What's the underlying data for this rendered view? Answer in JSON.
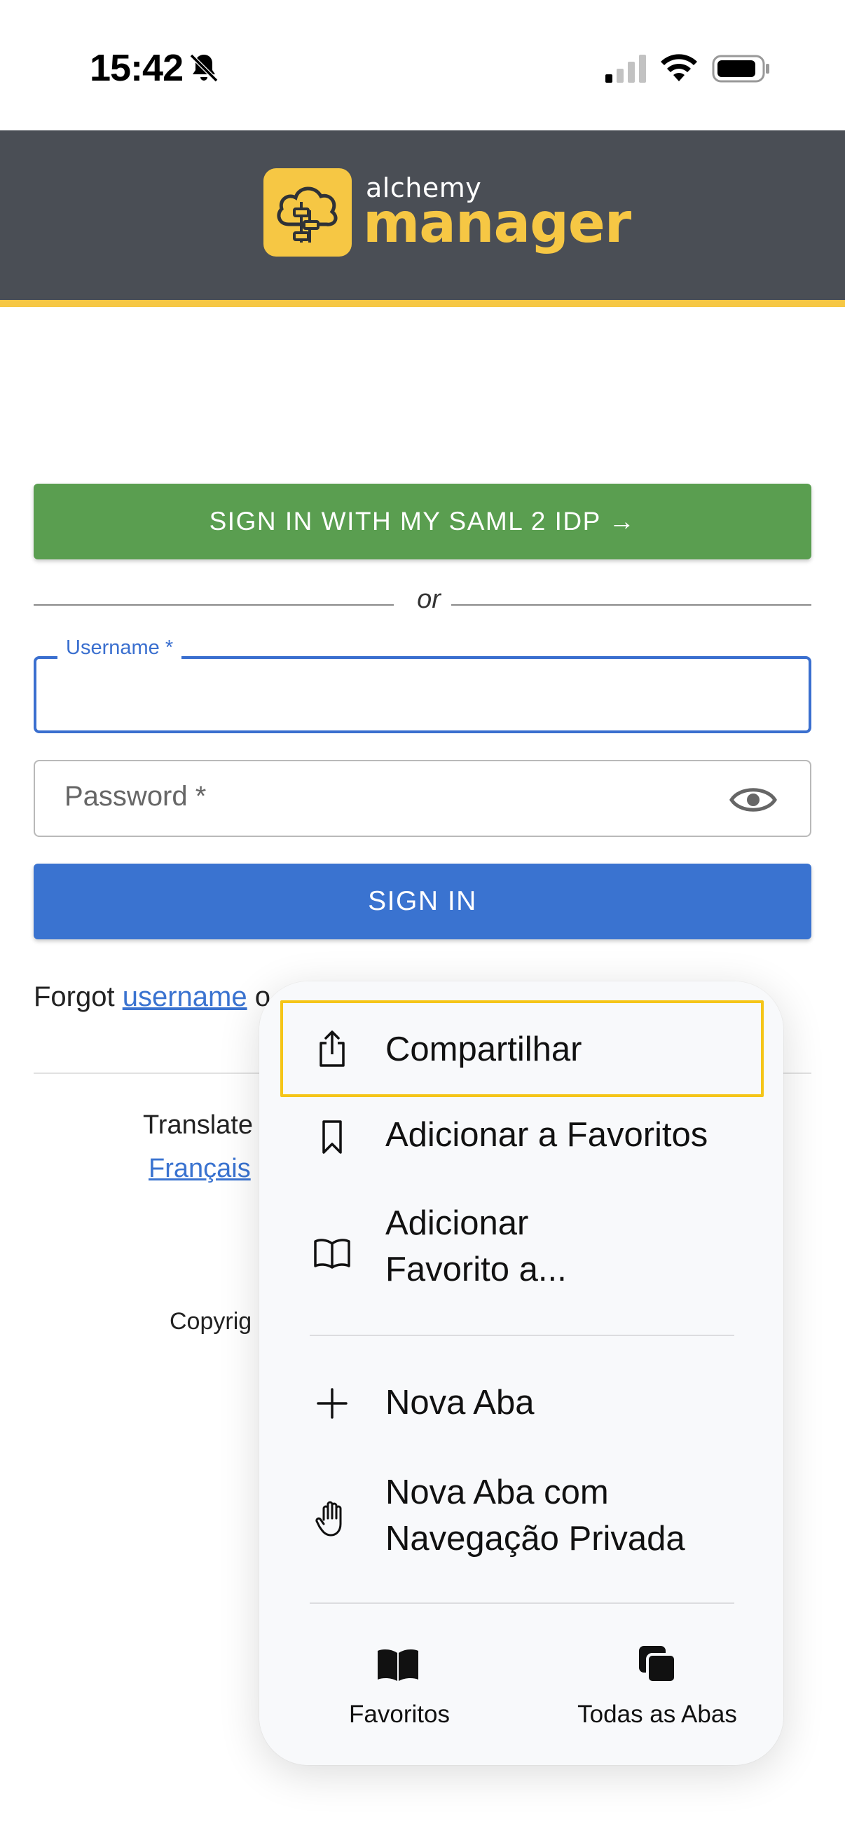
{
  "status_bar": {
    "time": "15:42",
    "icons": [
      "bell-slash-icon",
      "cellular-signal-icon",
      "wifi-icon",
      "battery-icon"
    ]
  },
  "header": {
    "logo_small": "alchemy",
    "logo_big": "manager",
    "colors": {
      "background": "#4a4e55",
      "accent": "#f6c744"
    }
  },
  "login": {
    "saml_button": "SIGN IN WITH MY SAML 2 IDP →",
    "or_text": "or",
    "username_label": "Username *",
    "password_placeholder": "Password *",
    "signin_button": "SIGN IN",
    "forgot_prefix": "Forgot ",
    "forgot_username_link": "username",
    "forgot_suffix": " o",
    "translate_text": "Translate",
    "francais_link": "Français",
    "copyright_text": "Copyrig",
    "colors": {
      "saml_green": "#5a9e50",
      "primary_blue": "#3a73d0"
    }
  },
  "context_menu": {
    "items": [
      {
        "icon": "share-icon",
        "label": "Compartilhar",
        "highlighted": true
      },
      {
        "icon": "bookmark-icon",
        "label": "Adicionar a Favoritos"
      },
      {
        "icon": "book-open-icon",
        "label": "Adicionar\nFavorito a..."
      },
      {
        "icon": "plus-icon",
        "label": "Nova Aba"
      },
      {
        "icon": "hand-icon",
        "label": "Nova Aba com\nNavegação Privada"
      }
    ],
    "bottom_buttons": [
      {
        "icon": "book-filled-icon",
        "label": "Favoritos"
      },
      {
        "icon": "tabs-icon",
        "label": "Todas as Abas"
      }
    ],
    "highlight_color": "#f5c518"
  }
}
